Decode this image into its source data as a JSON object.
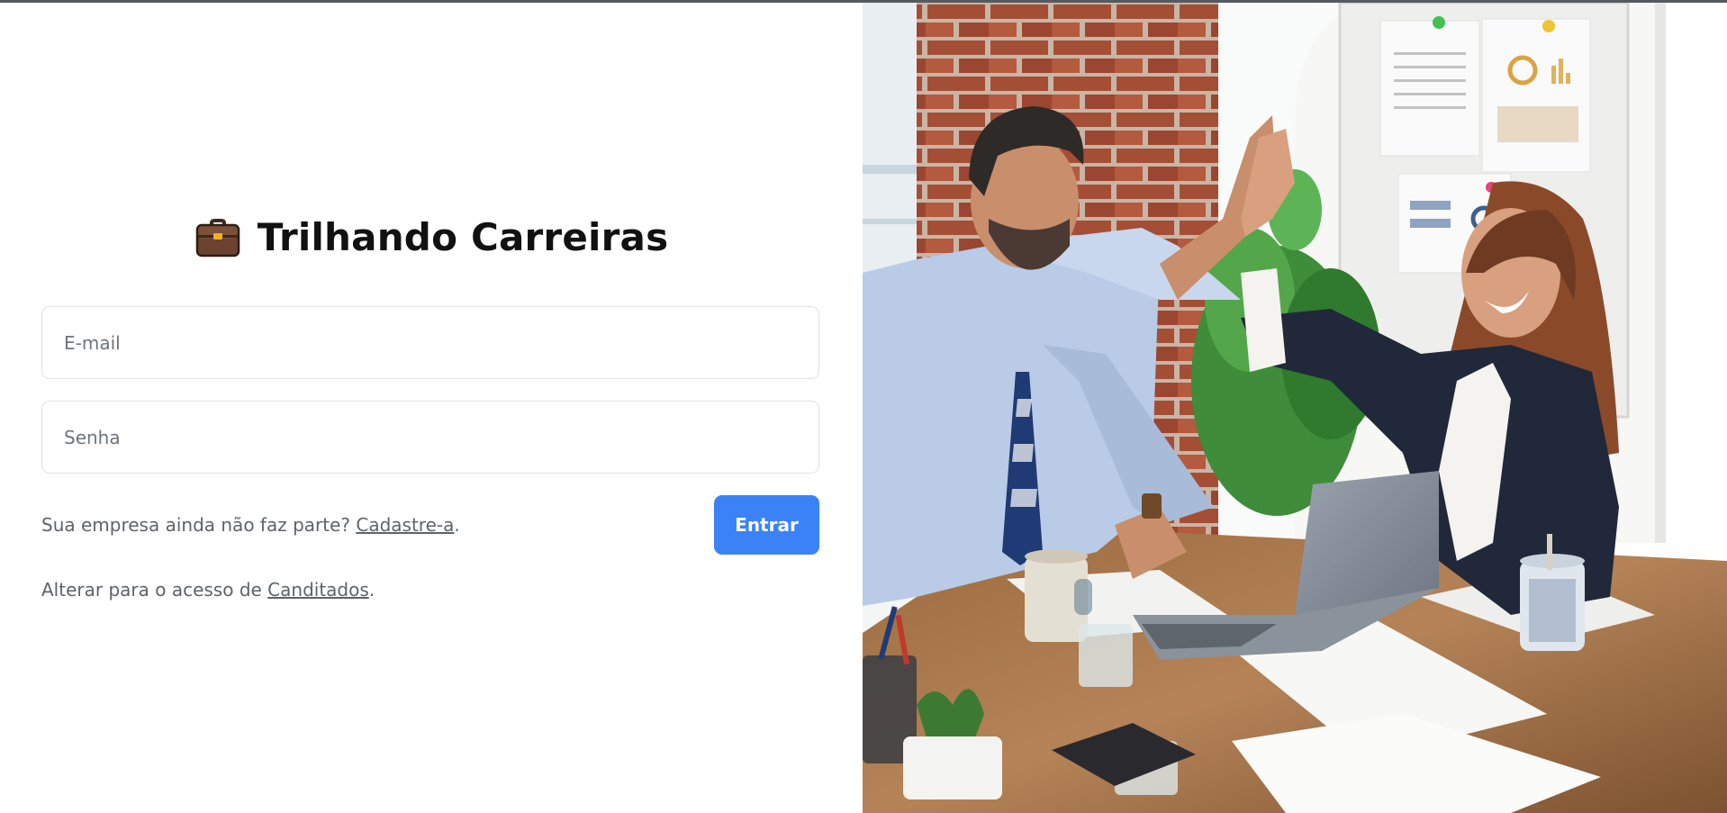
{
  "brand": {
    "title": "Trilhando Carreiras",
    "icon": "briefcase-icon"
  },
  "form": {
    "email_placeholder": "E-mail",
    "password_placeholder": "Senha",
    "submit_label": "Entrar"
  },
  "signup": {
    "prefix": "Sua empresa ainda não faz parte? ",
    "link_label": "Cadastre-a",
    "suffix": "."
  },
  "switch_access": {
    "prefix": "Alterar para o acesso de ",
    "link_label": "Canditados",
    "suffix": "."
  },
  "colors": {
    "accent": "#3b82f6",
    "muted_text": "#5f6368",
    "input_border": "#dfe3e8"
  }
}
